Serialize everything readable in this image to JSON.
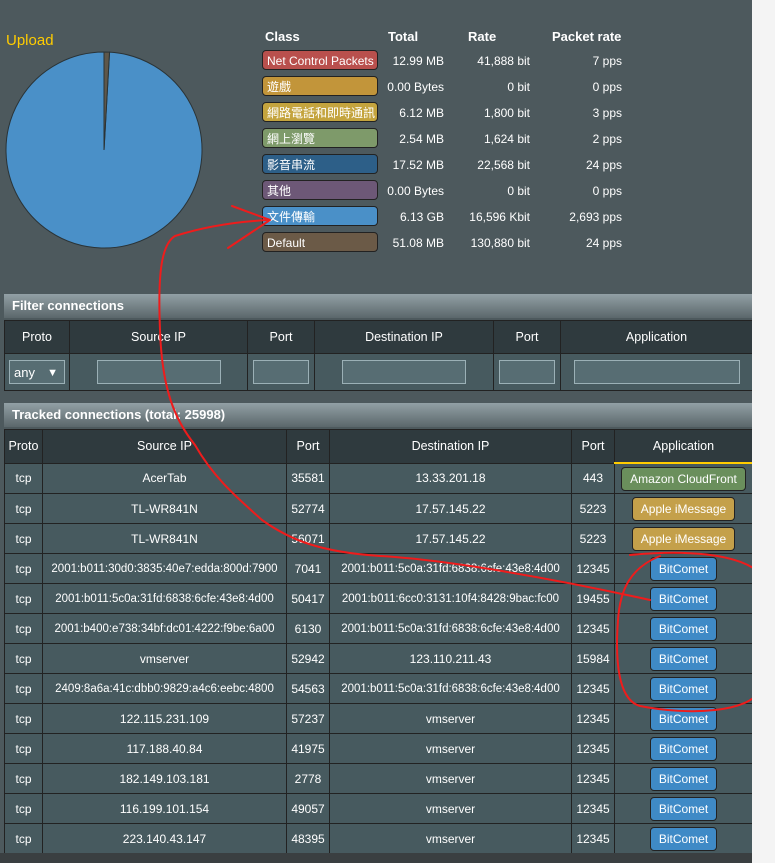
{
  "upload": {
    "title": "Upload",
    "pie": {
      "slices": [
        {
          "label": "文件傳輸",
          "share": 0.991,
          "color": "#4a90c8"
        },
        {
          "label": "Default",
          "share": 0.009,
          "color": "#5e574a"
        }
      ]
    }
  },
  "stats": {
    "headers": {
      "class": "Class",
      "total": "Total",
      "rate": "Rate",
      "pps": "Packet rate"
    },
    "rows": [
      {
        "class": "Net Control Packets",
        "total": "12.99 MB",
        "rate": "41,888 bit",
        "pps": "7 pps",
        "color": "#b9504d"
      },
      {
        "class": "遊戲",
        "total": "0.00 Bytes",
        "rate": "0 bit",
        "pps": "0 pps",
        "color": "#c2953a"
      },
      {
        "class": "網路電話和即時通訊",
        "total": "6.12 MB",
        "rate": "1,800 bit",
        "pps": "3 pps",
        "color": "#c4a43e"
      },
      {
        "class": "網上瀏覽",
        "total": "2.54 MB",
        "rate": "1,624 bit",
        "pps": "2 pps",
        "color": "#7e9a6a"
      },
      {
        "class": "影音串流",
        "total": "17.52 MB",
        "rate": "22,568 bit",
        "pps": "24 pps",
        "color": "#2d5f88"
      },
      {
        "class": "其他",
        "total": "0.00 Bytes",
        "rate": "0 bit",
        "pps": "0 pps",
        "color": "#6d5877"
      },
      {
        "class": "文件傳輸",
        "total": "6.13 GB",
        "rate": "16,596 Kbit",
        "pps": "2,693 pps",
        "color": "#4a90c8"
      },
      {
        "class": "Default",
        "total": "51.08 MB",
        "rate": "130,880 bit",
        "pps": "24 pps",
        "color": "#6b5a47"
      }
    ]
  },
  "filter": {
    "title": "Filter connections",
    "headers": {
      "proto": "Proto",
      "source_ip": "Source IP",
      "port": "Port",
      "destination_ip": "Destination IP",
      "port2": "Port",
      "application": "Application"
    },
    "proto_value": "any"
  },
  "tracked": {
    "title": "Tracked connections (total: 25998)",
    "headers": {
      "proto": "Proto",
      "source_ip": "Source IP",
      "port": "Port",
      "destination_ip": "Destination IP",
      "port2": "Port",
      "application": "Application"
    },
    "rows": [
      {
        "proto": "tcp",
        "src": "AcerTab",
        "sport": "35581",
        "dst": "13.33.201.18",
        "dport": "443",
        "app": "Amazon CloudFront",
        "app_color": "#6a8f5c"
      },
      {
        "proto": "tcp",
        "src": "TL-WR841N",
        "sport": "52774",
        "dst": "17.57.145.22",
        "dport": "5223",
        "app": "Apple iMessage",
        "app_color": "#c4a04a"
      },
      {
        "proto": "tcp",
        "src": "TL-WR841N",
        "sport": "56071",
        "dst": "17.57.145.22",
        "dport": "5223",
        "app": "Apple iMessage",
        "app_color": "#c4a04a"
      },
      {
        "proto": "tcp",
        "src": "2001:b011:30d0:3835:40e7:edda:800d:7900",
        "sport": "7041",
        "dst": "2001:b011:5c0a:31fd:6838:6cfe:43e8:4d00",
        "dport": "12345",
        "app": "BitComet",
        "app_color": "#3f8ac6"
      },
      {
        "proto": "tcp",
        "src": "2001:b011:5c0a:31fd:6838:6cfe:43e8:4d00",
        "sport": "50417",
        "dst": "2001:b011:6cc0:3131:10f4:8428:9bac:fc00",
        "dport": "19455",
        "app": "BitComet",
        "app_color": "#3f8ac6"
      },
      {
        "proto": "tcp",
        "src": "2001:b400:e738:34bf:dc01:4222:f9be:6a00",
        "sport": "6130",
        "dst": "2001:b011:5c0a:31fd:6838:6cfe:43e8:4d00",
        "dport": "12345",
        "app": "BitComet",
        "app_color": "#3f8ac6"
      },
      {
        "proto": "tcp",
        "src": "vmserver",
        "sport": "52942",
        "dst": "123.110.211.43",
        "dport": "15984",
        "app": "BitComet",
        "app_color": "#3f8ac6"
      },
      {
        "proto": "tcp",
        "src": "2409:8a6a:41c:dbb0:9829:a4c6:eebc:4800",
        "sport": "54563",
        "dst": "2001:b011:5c0a:31fd:6838:6cfe:43e8:4d00",
        "dport": "12345",
        "app": "BitComet",
        "app_color": "#3f8ac6"
      },
      {
        "proto": "tcp",
        "src": "122.115.231.109",
        "sport": "57237",
        "dst": "vmserver",
        "dport": "12345",
        "app": "BitComet",
        "app_color": "#3f8ac6"
      },
      {
        "proto": "tcp",
        "src": "117.188.40.84",
        "sport": "41975",
        "dst": "vmserver",
        "dport": "12345",
        "app": "BitComet",
        "app_color": "#3f8ac6"
      },
      {
        "proto": "tcp",
        "src": "182.149.103.181",
        "sport": "2778",
        "dst": "vmserver",
        "dport": "12345",
        "app": "BitComet",
        "app_color": "#3f8ac6"
      },
      {
        "proto": "tcp",
        "src": "116.199.101.154",
        "sport": "49057",
        "dst": "vmserver",
        "dport": "12345",
        "app": "BitComet",
        "app_color": "#3f8ac6"
      },
      {
        "proto": "tcp",
        "src": "223.140.43.147",
        "sport": "48395",
        "dst": "vmserver",
        "dport": "12345",
        "app": "BitComet",
        "app_color": "#3f8ac6"
      }
    ]
  },
  "annotation_color": "#ee1c1c"
}
